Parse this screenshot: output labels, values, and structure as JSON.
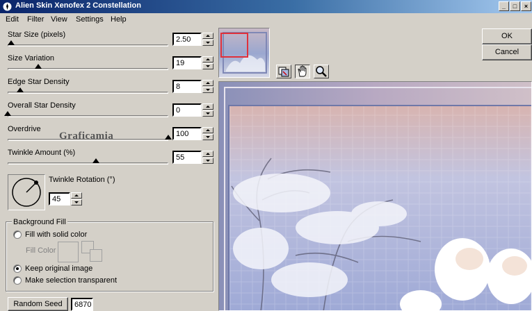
{
  "window": {
    "title": "Alien Skin Xenofex 2 Constellation",
    "controls": {
      "minimize": "_",
      "maximize": "□",
      "close": "×"
    }
  },
  "menu": [
    "Edit",
    "Filter",
    "View",
    "Settings",
    "Help"
  ],
  "params": [
    {
      "label": "Star Size (pixels)",
      "value": "2.50",
      "level": 0.02
    },
    {
      "label": "Size Variation",
      "value": "19",
      "level": 0.19
    },
    {
      "label": "Edge Star Density",
      "value": "8",
      "level": 0.08
    },
    {
      "label": "Overall Star Density",
      "value": "0",
      "level": 0.0
    },
    {
      "label": "Overdrive",
      "value": "100",
      "level": 1.0
    },
    {
      "label": "Twinkle Amount (%)",
      "value": "55",
      "level": 0.55
    }
  ],
  "watermark": "Graficamia",
  "twinkle_rotation": {
    "label": "Twinkle Rotation (°)",
    "value": "45"
  },
  "background_fill": {
    "title": "Background Fill",
    "options": [
      {
        "label": "Fill with solid color",
        "checked": false
      },
      {
        "label": "Keep original image",
        "checked": true
      },
      {
        "label": "Make selection transparent",
        "checked": false
      }
    ],
    "fill_color_label": "Fill Color"
  },
  "random_seed": {
    "button": "Random Seed",
    "value": "6870"
  },
  "buttons": {
    "ok": "OK",
    "cancel": "Cancel"
  },
  "icons": [
    "appicon",
    "preview-toggle-icon",
    "hand-icon",
    "zoom-icon"
  ]
}
